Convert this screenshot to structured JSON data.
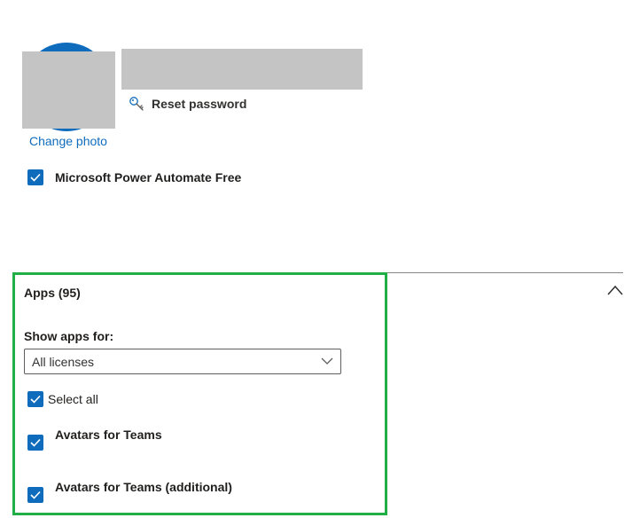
{
  "profile": {
    "change_photo_label": "Change photo",
    "reset_password_label": "Reset password"
  },
  "licenses": {
    "items": [
      {
        "label": "Microsoft Power Automate Free",
        "checked": true
      }
    ]
  },
  "apps": {
    "title": "Apps (95)",
    "show_apps_for_label": "Show apps for:",
    "filter_selected": "All licenses",
    "select_all_label": "Select all",
    "items": [
      {
        "label": "Avatars for Teams",
        "checked": true
      },
      {
        "label": "Avatars for Teams (additional)",
        "checked": true
      }
    ]
  },
  "colors": {
    "accent": "#0f6cbd",
    "highlight_border": "#20ae46",
    "redaction": "#c4c4c4"
  },
  "icons": {
    "reset_password": "key-icon",
    "collapse": "chevron-up-icon",
    "dropdown": "chevron-down-icon",
    "checkbox": "checkmark-icon"
  }
}
